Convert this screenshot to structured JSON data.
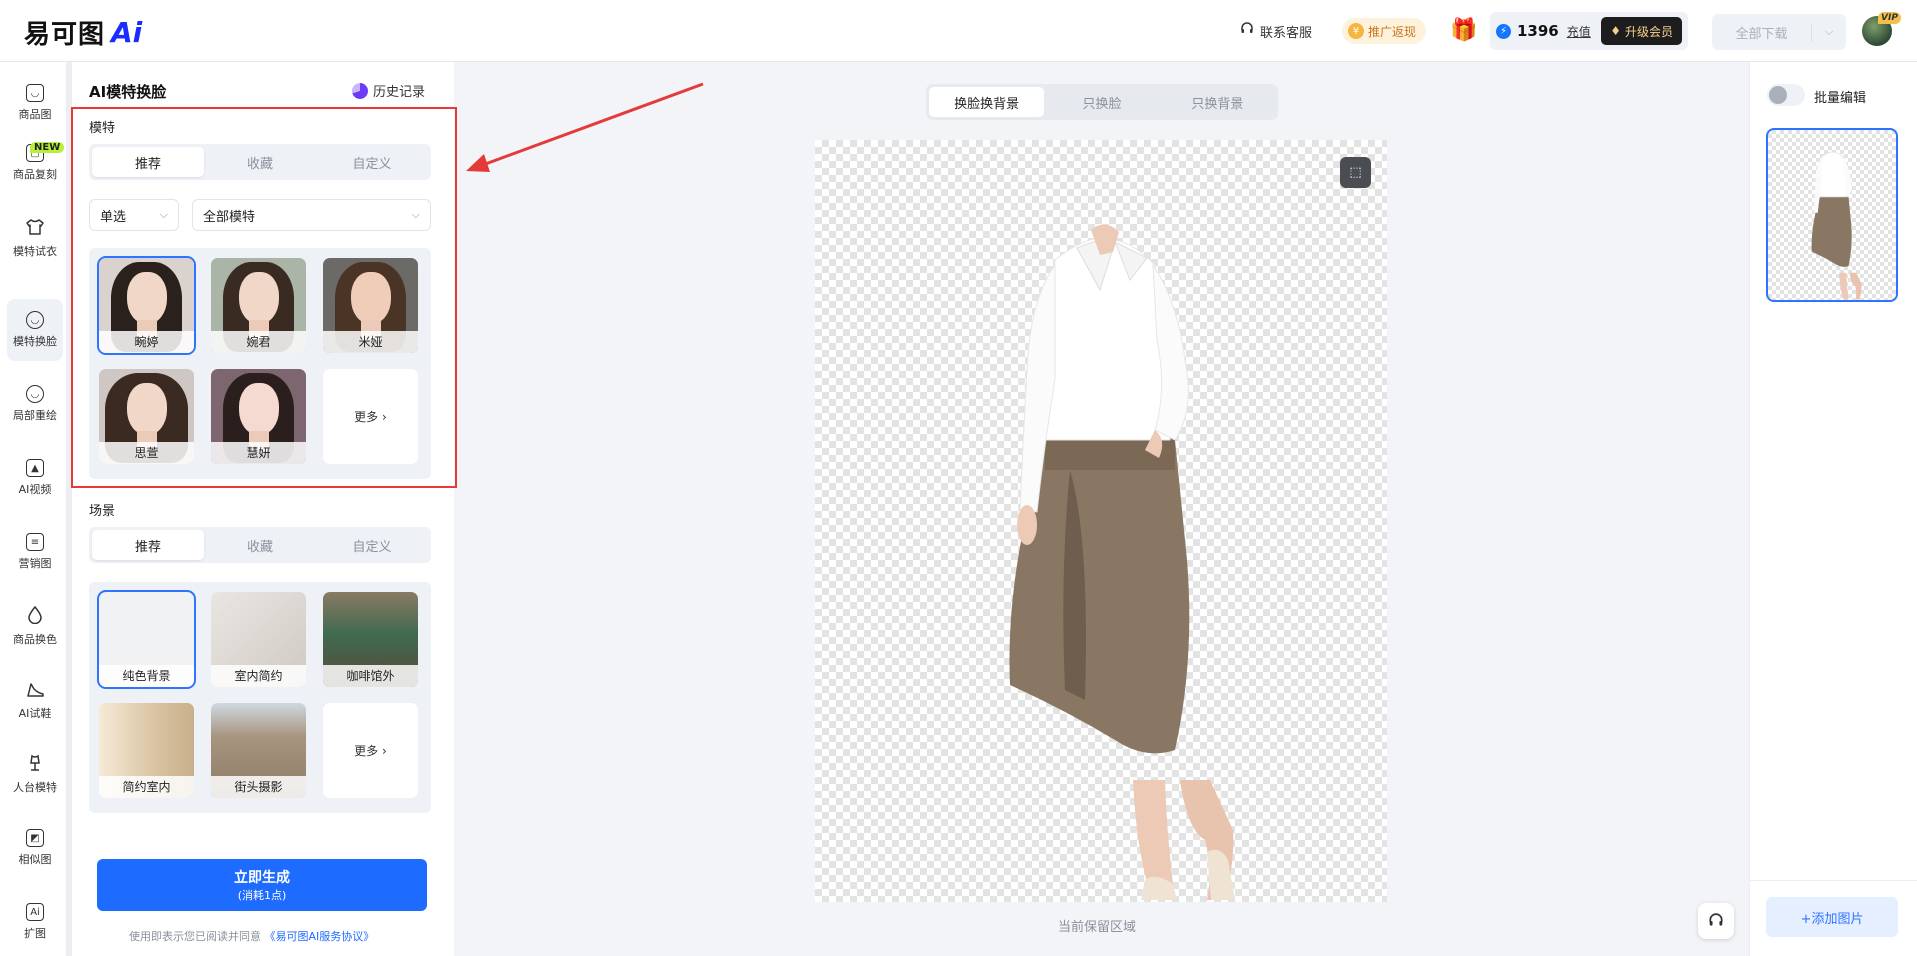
{
  "header": {
    "logo_text": "易可图",
    "logo_ai": "Ai",
    "support": "联系客服",
    "promo": "推广返现",
    "points": "1396",
    "recharge": "充值",
    "upgrade": "升级会员",
    "download_all": "全部下载",
    "vip": "VIP"
  },
  "nav": {
    "new_badge": "NEW",
    "items": [
      {
        "label": "商品图",
        "icon": "image-icon"
      },
      {
        "label": "商品复刻",
        "icon": "copy-icon"
      },
      {
        "label": "模特试衣",
        "icon": "shirt-icon"
      },
      {
        "label": "模特换脸",
        "icon": "face-icon"
      },
      {
        "label": "局部重绘",
        "icon": "redraw-icon"
      },
      {
        "label": "AI视频",
        "icon": "video-icon"
      },
      {
        "label": "营销图",
        "icon": "marketing-icon"
      },
      {
        "label": "商品换色",
        "icon": "color-drop-icon"
      },
      {
        "label": "AI试鞋",
        "icon": "shoe-icon"
      },
      {
        "label": "人台模特",
        "icon": "mannequin-icon"
      },
      {
        "label": "相似图",
        "icon": "similar-icon"
      },
      {
        "label": "扩图",
        "icon": "expand-icon"
      }
    ],
    "active_index": 3
  },
  "panel": {
    "title": "AI模特换脸",
    "history": "历史记录",
    "model_section": "模特",
    "model_tabs": [
      "推荐",
      "收藏",
      "自定义"
    ],
    "select_mode": "单选",
    "select_filter": "全部模特",
    "models": [
      "畹婷",
      "婉君",
      "米娅",
      "思萱",
      "慧妍"
    ],
    "more": "更多",
    "scene_section": "场景",
    "scene_tabs": [
      "推荐",
      "收藏",
      "自定义"
    ],
    "scenes": [
      "纯色背景",
      "室内简约",
      "咖啡馆外",
      "简约室内",
      "街头摄影"
    ],
    "generate_main": "立即生成",
    "generate_sub": "(消耗1点)",
    "agreement": "使用即表示您已阅读并同意",
    "agreement_link": "《易可图AI服务协议》"
  },
  "canvas": {
    "mode_tabs": [
      "换脸换背景",
      "只换脸",
      "只换背景"
    ],
    "keep_area": "当前保留区域"
  },
  "right": {
    "batch_edit": "批量编辑",
    "add_image": "+添加图片"
  },
  "colors": {
    "accent": "#1e6bff",
    "highlight_border": "#e53a3a",
    "new_badge": "#b7f03a"
  }
}
